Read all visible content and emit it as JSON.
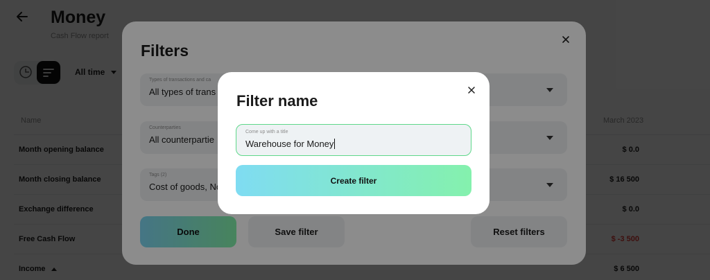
{
  "page": {
    "title": "Money",
    "subtitle": "Cash Flow report",
    "period": "All time"
  },
  "table": {
    "col_name": "Name",
    "col_month": "March 2023",
    "rows": [
      {
        "label": "Month opening balance",
        "value": "$ 0.0"
      },
      {
        "label": "Month closing balance",
        "value": "$ 16 500"
      },
      {
        "label": "Exchange difference",
        "value": "$ 0.0"
      },
      {
        "label": "Free Cash Flow",
        "value": "$ -3 500"
      },
      {
        "label": "Income",
        "value": "$ 6 500"
      }
    ]
  },
  "filters": {
    "title": "Filters",
    "fields": [
      {
        "label": "Types of transactions and ca",
        "value": "All types of trans"
      },
      {
        "label": "Counterparties",
        "value": "All counterpartie"
      },
      {
        "label": "Tags (2)",
        "value": "Cost of goods, No ta"
      }
    ],
    "done_label": "Done",
    "save_label": "Save filter",
    "reset_label": "Reset filters"
  },
  "dialog": {
    "title": "Filter name",
    "input_label": "Come up with a title",
    "input_value": "Warehouse for Money",
    "create_label": "Create filter"
  },
  "colors": {
    "accent_gradient_start": "#7fdcf2",
    "accent_gradient_end": "#84f1ad",
    "input_border": "#5ed88a",
    "negative": "#e53935"
  }
}
